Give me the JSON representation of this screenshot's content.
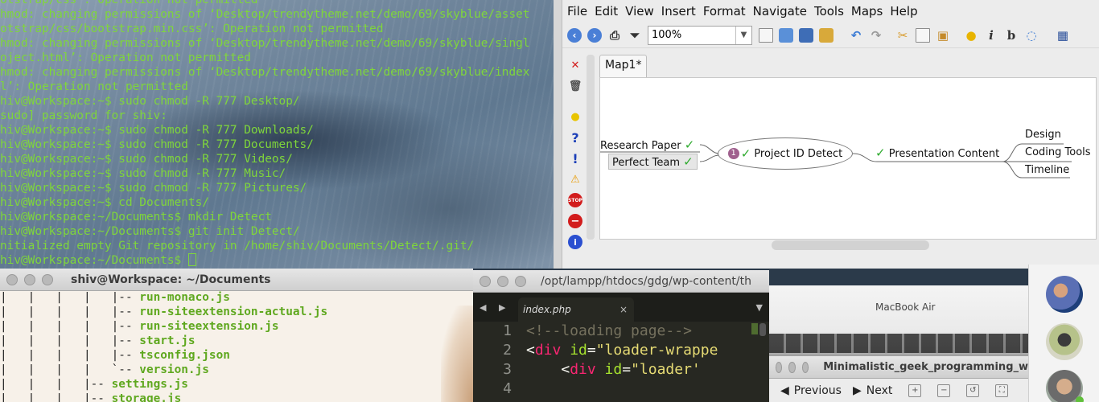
{
  "terminal_top": {
    "lines": [
      "otstrap/css': Operation not permitted",
      "hmod: changing permissions of ‘Desktop/trendytheme.net/demo/69/skyblue/asset",
      "otstrap/css/bootstrap.min.css’: Operation not permitted",
      "hmod: changing permissions of ‘Desktop/trendytheme.net/demo/69/skyblue/singl",
      "oject.html’: Operation not permitted",
      "hmod: changing permissions of ‘Desktop/trendytheme.net/demo/69/skyblue/index",
      "l’: Operation not permitted",
      "hiv@Workspace:~$ sudo chmod -R 777 Desktop/",
      "sudo] password for shiv:",
      "hiv@Workspace:~$ sudo chmod -R 777 Downloads/",
      "hiv@Workspace:~$ sudo chmod -R 777 Documents/",
      "hiv@Workspace:~$ sudo chmod -R 777 Videos/",
      "hiv@Workspace:~$ sudo chmod -R 777 Music/",
      "hiv@Workspace:~$ sudo chmod -R 777 Pictures/",
      "hiv@Workspace:~$ cd Documents/",
      "hiv@Workspace:~/Documents$ mkdir Detect",
      "hiv@Workspace:~/Documents$ git init Detect/",
      "nitialized empty Git repository in /home/shiv/Documents/Detect/.git/",
      "hiv@Workspace:~/Documents$ "
    ]
  },
  "freemind": {
    "menu": [
      "File",
      "Edit",
      "View",
      "Insert",
      "Format",
      "Navigate",
      "Tools",
      "Maps",
      "Help"
    ],
    "zoom": "100%",
    "tab": "Map1*",
    "nodes": {
      "root": "Project ID Detect",
      "research": "Research Paper",
      "perfect": "Perfect Team",
      "presentation": "Presentation Content",
      "design": "Design",
      "coding": "Coding Tools",
      "timeline": "Timeline"
    },
    "root_icon_number": "1",
    "colors": {
      "check": "#2eaa2e",
      "root_icon": "#a0608e"
    }
  },
  "terminal_bottom": {
    "title": "shiv@Workspace: ~/Documents",
    "tree": [
      {
        "prefix": "|   |   |   |   |-- ",
        "name": "run-monaco.js"
      },
      {
        "prefix": "|   |   |   |   |-- ",
        "name": "run-siteextension-actual.js"
      },
      {
        "prefix": "|   |   |   |   |-- ",
        "name": "run-siteextension.js"
      },
      {
        "prefix": "|   |   |   |   |-- ",
        "name": "start.js"
      },
      {
        "prefix": "|   |   |   |   |-- ",
        "name": "tsconfig.json"
      },
      {
        "prefix": "|   |   |   |   `-- ",
        "name": "version.js"
      },
      {
        "prefix": "|   |   |   |-- ",
        "name": "settings.js"
      },
      {
        "prefix": "|   |   |   |-- ",
        "name": "storage.js"
      }
    ]
  },
  "editor": {
    "title": "/opt/lampp/htdocs/gdg/wp-content/th",
    "tab": "index.php",
    "tab_close": "×",
    "lines": [
      {
        "num": "1",
        "comment": "<!--loading page-->"
      },
      {
        "num": "2",
        "open": "<",
        "tag": "div",
        "attr": " id",
        "eq": "=",
        "str": "\"loader-wrappe"
      },
      {
        "num": "3",
        "indent": "    ",
        "open": "<",
        "tag": "div",
        "attr": " id",
        "eq": "=",
        "str": "\"loader'"
      },
      {
        "num": "4"
      }
    ]
  },
  "viewer": {
    "title": "Minimalistic_geek_programming_w",
    "photo_text": "MacBook Air",
    "prev": "Previous",
    "next": "Next"
  }
}
